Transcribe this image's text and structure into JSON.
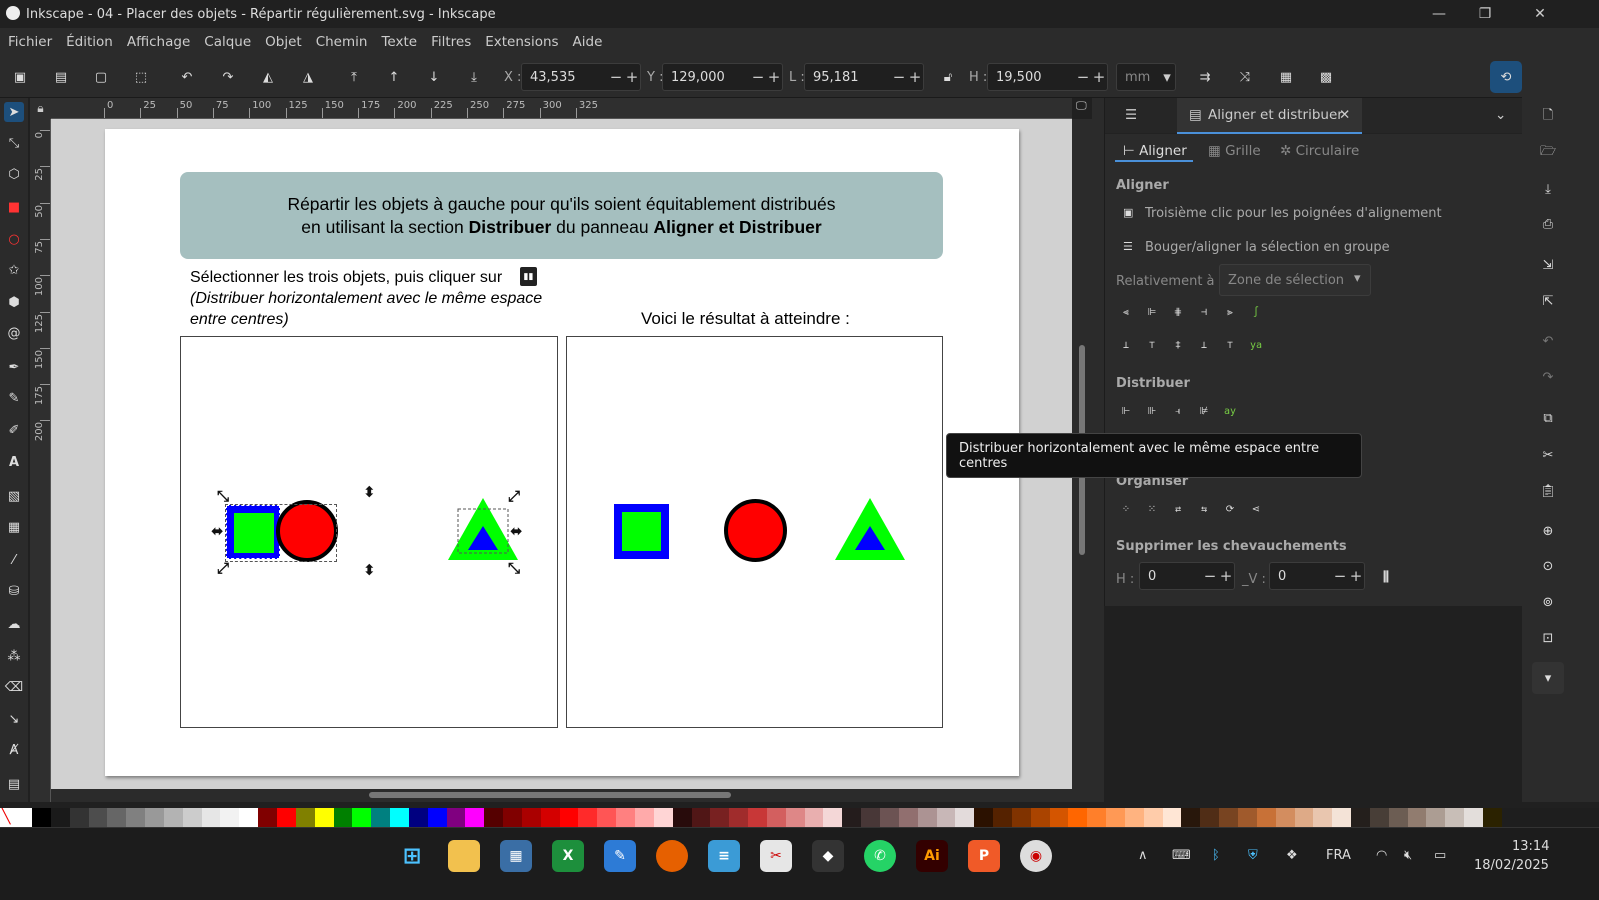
{
  "window": {
    "title": "Inkscape - 04 - Placer des objets - Répartir régulièrement.svg - Inkscape",
    "minimize": "—",
    "maximize": "❐",
    "close": "✕"
  },
  "menu": [
    "Fichier",
    "Édition",
    "Affichage",
    "Calque",
    "Objet",
    "Chemin",
    "Texte",
    "Filtres",
    "Extensions",
    "Aide"
  ],
  "toolctl": {
    "x_label": "X :",
    "x_value": "43,535",
    "y_label": "Y :",
    "y_value": "129,000",
    "w_label": "L :",
    "w_value": "95,181",
    "h_label": "H :",
    "h_value": "19,500",
    "unit": "mm"
  },
  "ruler_h": [
    "0",
    "25",
    "50",
    "75",
    "100",
    "125",
    "150",
    "175",
    "200",
    "225",
    "250",
    "275",
    "300",
    "325"
  ],
  "ruler_v": [
    "0",
    "25",
    "50",
    "75",
    "100",
    "125",
    "150",
    "175",
    "200"
  ],
  "doc": {
    "banner_line1": "Répartir les objets à gauche pour qu'ils soient équitablement distribués",
    "banner_line2a": "en utilisant la section ",
    "banner_line2b": "Distribuer",
    "banner_line2c": " du panneau ",
    "banner_line2d": "Aligner et Distribuer",
    "instr1": "Sélectionner les trois objets, puis cliquer sur",
    "instr2": "(Distribuer horizontalement avec le même espace",
    "instr3": "entre centres)",
    "result": "Voici le résultat à atteindre :"
  },
  "panel": {
    "tab_title": "Aligner et distribuer",
    "subtabs": [
      "Aligner",
      "Grille",
      "Circulaire"
    ],
    "sec_aligner": "Aligner",
    "opt1": "Troisième clic pour les poignées d'alignement",
    "opt2": "Bouger/aligner la sélection en groupe",
    "rel_label": "Relativement à :",
    "rel_value": "Zone de sélection",
    "sec_distribuer": "Distribuer",
    "sec_organiser": "Organiser",
    "sec_overlap": "Supprimer les chevauchements",
    "h_label": "H :",
    "h_value": "0",
    "v_label": "_V :",
    "v_value": "0"
  },
  "tooltip": "Distribuer horizontalement avec le même espace entre centres",
  "tray": {
    "lang": "FRA",
    "time": "13:14",
    "date": "18/02/2025"
  },
  "palette": [
    "#000000",
    "#1a1a1a",
    "#333333",
    "#4d4d4d",
    "#666666",
    "#808080",
    "#999999",
    "#b3b3b3",
    "#cccccc",
    "#e6e6e6",
    "#f2f2f2",
    "#ffffff",
    "#800000",
    "#ff0000",
    "#808000",
    "#ffff00",
    "#008000",
    "#00ff00",
    "#008080",
    "#00ffff",
    "#000080",
    "#0000ff",
    "#800080",
    "#ff00ff",
    "#550000",
    "#800000",
    "#aa0000",
    "#d40000",
    "#ff0000",
    "#ff2a2a",
    "#ff5555",
    "#ff8080",
    "#ffaaaa",
    "#ffd5d5",
    "#280b0b",
    "#501616",
    "#782121",
    "#a02c2c",
    "#c83737",
    "#d35f5f",
    "#de8787",
    "#e9afaf",
    "#f4d7d7",
    "#241c1c",
    "#483737",
    "#6c5353",
    "#916f6f",
    "#ac9393",
    "#c8b7b7",
    "#e3dbdb",
    "#2b1100",
    "#552200",
    "#803300",
    "#aa4400",
    "#d45500",
    "#ff6600",
    "#ff7f2a",
    "#ff9955",
    "#ffb380",
    "#ffccaa",
    "#ffe6d5",
    "#28170b",
    "#502d16",
    "#784421",
    "#a05a2c",
    "#c87137",
    "#d38d5f",
    "#deaa87",
    "#e9c6af",
    "#f4e3d7",
    "#241f1c",
    "#483e37",
    "#6c5d53",
    "#917c6f",
    "#ac9d93",
    "#c8beb7",
    "#e3dedb",
    "#2b2200"
  ]
}
